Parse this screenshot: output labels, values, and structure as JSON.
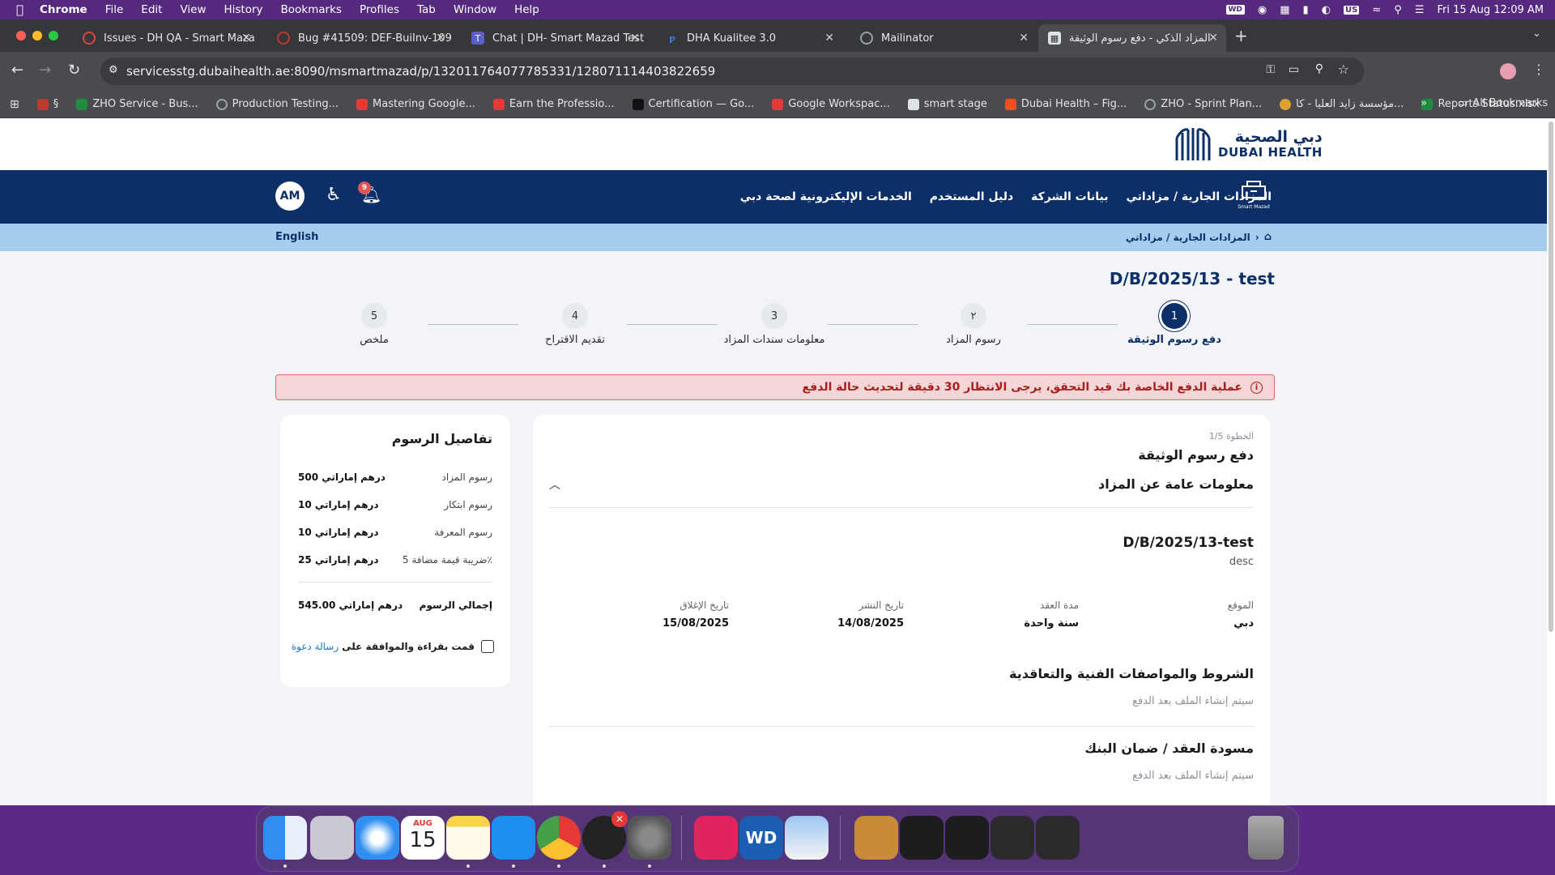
{
  "menubar": {
    "app": "Chrome",
    "items": [
      "File",
      "Edit",
      "View",
      "History",
      "Bookmarks",
      "Profiles",
      "Tab",
      "Window",
      "Help"
    ],
    "status_icons": [
      "wd-icon",
      "creative-cloud-icon",
      "grid-icon",
      "battery-icon",
      "control-icon",
      "input-source-icon",
      "wifi-icon",
      "search-icon",
      "control-center-icon"
    ],
    "input_source": "US",
    "datetime": "Fri 15 Aug  12:09 AM"
  },
  "tabs": [
    {
      "title": "Issues - DH QA - Smart Maza",
      "icon": "jira-icon",
      "color": "#e3443a"
    },
    {
      "title": "Bug #41509: DEF-BuiInv-109",
      "icon": "redmine-icon",
      "color": "#c0392b"
    },
    {
      "title": "Chat | DH- Smart Mazad Test",
      "icon": "teams-icon",
      "color": "#5b5fc7"
    },
    {
      "title": "DHA Kualitee 3.0",
      "icon": "kualitee-icon",
      "color": "#3d7be0"
    },
    {
      "title": "Mailinator",
      "icon": "globe-icon",
      "color": "#9aa0a6"
    },
    {
      "title": "المزاد الذكي - دفع رسوم الوثيقة",
      "icon": "calendar-icon",
      "color": "#dfe3e8"
    }
  ],
  "toolbar": {
    "url": "servicesstg.dubaihealth.ae:8090/msmartmazad/p/132011764077785331/128071114403822659"
  },
  "bookmarks": [
    {
      "label": "§",
      "color": "#c0392b"
    },
    {
      "label": "ZHO Service - Bus...",
      "color": "#1e8e3e"
    },
    {
      "label": "Production Testing...",
      "color": "#9aa0a6"
    },
    {
      "label": "Mastering Google...",
      "color": "#e53935"
    },
    {
      "label": "Earn the Professio...",
      "color": "#e53935"
    },
    {
      "label": "Certification — Go...",
      "color": "#111111"
    },
    {
      "label": "Google Workspac...",
      "color": "#e53935"
    },
    {
      "label": "smart stage",
      "color": "#dfe3e8"
    },
    {
      "label": "Dubai Health – Fig...",
      "color": "#f24e1e"
    },
    {
      "label": "ZHO - Sprint Plan...",
      "color": "#9aa0a6"
    },
    {
      "label": "مؤسسة زايد العليا - كا...",
      "color": "#e0a030"
    },
    {
      "label": "Reports Status.xlsx",
      "color": "#1e8e3e"
    }
  ],
  "bookmarks_all": "All Bookmarks",
  "site": {
    "logo_ar": "دبي الصحية",
    "logo_en": "DUBAI HEALTH",
    "nav_items": [
      "المزادات الجارية / مزاداتي",
      "بيانات الشركة",
      "دليل المستخدم",
      "الخدمات الإليكترونية لصحة دبي"
    ],
    "smart_mazad_label": "Smart Mazad",
    "notification_count": "9",
    "avatar": "AM",
    "breadcrumb": "المزادات الجارية / مزاداتي",
    "language": "English",
    "page_title": "D/B/2025/13 - test",
    "steps": [
      {
        "num": "1",
        "label": "دفع رسوم الوثيقة",
        "active": true
      },
      {
        "num": "٢",
        "label": "رسوم المزاد",
        "active": false
      },
      {
        "num": "3",
        "label": "معلومات سندات المزاد",
        "active": false
      },
      {
        "num": "4",
        "label": "تقديم الاقتراح",
        "active": false
      },
      {
        "num": "5",
        "label": "ملخص",
        "active": false
      }
    ],
    "alert": "عملية الدفع الخاصة بك قيد التحقق، يرجى الانتظار 30 دقيقة لتحديث حالة الدفع",
    "fees": {
      "title": "تفاصيل الرسوم",
      "rows": [
        {
          "label": "رسوم المزاد",
          "value": "500 درهم إماراتي"
        },
        {
          "label": "رسوم ابتكار",
          "value": "10 درهم إماراتي"
        },
        {
          "label": "رسوم المعرفة",
          "value": "10 درهم إماراتي"
        },
        {
          "label": "ضريبة قيمة مضافة 5٪",
          "value": "25 درهم إماراتي"
        }
      ],
      "total_label": "إجمالي الرسوم",
      "total_value": "545.00 درهم إماراتي",
      "agree_text": "قمت بقراءة والموافقة على",
      "agree_link": "رسالة دعوة"
    },
    "main": {
      "step_label": "الخطوة 1/5",
      "step_title": "دفع رسوم الوثيقة",
      "section_title": "معلومات عامة عن المزاد",
      "auction_name": "D/B/2025/13-test",
      "auction_desc": "desc",
      "info": [
        {
          "label": "الموقع",
          "value": "دبي"
        },
        {
          "label": "مدة العقد",
          "value": "سنة واحدة"
        },
        {
          "label": "تاريخ النشر",
          "value": "14/08/2025"
        },
        {
          "label": "تاريخ الإغلاق",
          "value": "15/08/2025"
        }
      ],
      "terms_title": "الشروط والمواصفات الفنية والتعاقدية",
      "terms_note": "سيتم إنشاء الملف بعد الدفع",
      "contract_title": "مسودة العقد / ضمان البنك",
      "contract_note": "سيتم إنشاء الملف بعد الدفع"
    }
  },
  "dock": {
    "calendar_month": "AUG",
    "calendar_day": "15"
  }
}
